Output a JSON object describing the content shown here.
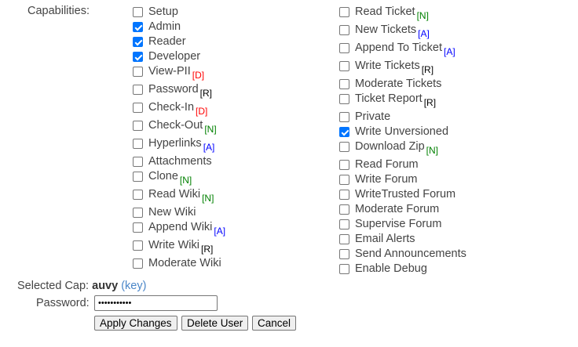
{
  "capabilities_label": "Capabilities:",
  "flag_colors": {
    "D": "#ff0000",
    "N": "#008000",
    "A": "#0000ff",
    "R": "#000000"
  },
  "left_column": [
    {
      "label": "Setup",
      "checked": false,
      "flag": ""
    },
    {
      "label": "Admin",
      "checked": true,
      "flag": ""
    },
    {
      "label": "Reader",
      "checked": true,
      "flag": ""
    },
    {
      "label": "Developer",
      "checked": true,
      "flag": ""
    },
    {
      "label": "View-PII",
      "checked": false,
      "flag": "D"
    },
    {
      "label": "Password",
      "checked": false,
      "flag": "R"
    },
    {
      "label": "Check-In",
      "checked": false,
      "flag": "D"
    },
    {
      "label": "Check-Out",
      "checked": false,
      "flag": "N"
    },
    {
      "label": "Hyperlinks",
      "checked": false,
      "flag": "A"
    },
    {
      "label": "Attachments",
      "checked": false,
      "flag": ""
    },
    {
      "label": "Clone",
      "checked": false,
      "flag": "N"
    },
    {
      "label": "Read Wiki",
      "checked": false,
      "flag": "N"
    },
    {
      "label": "New Wiki",
      "checked": false,
      "flag": ""
    },
    {
      "label": "Append Wiki",
      "checked": false,
      "flag": "A"
    },
    {
      "label": "Write Wiki",
      "checked": false,
      "flag": "R"
    },
    {
      "label": "Moderate Wiki",
      "checked": false,
      "flag": ""
    }
  ],
  "right_column": [
    {
      "label": "Read Ticket",
      "checked": false,
      "flag": "N"
    },
    {
      "label": "New Tickets",
      "checked": false,
      "flag": "A"
    },
    {
      "label": "Append To Ticket",
      "checked": false,
      "flag": "A"
    },
    {
      "label": "Write Tickets",
      "checked": false,
      "flag": "R"
    },
    {
      "label": "Moderate Tickets",
      "checked": false,
      "flag": ""
    },
    {
      "label": "Ticket Report",
      "checked": false,
      "flag": "R"
    },
    {
      "label": "Private",
      "checked": false,
      "flag": ""
    },
    {
      "label": "Write Unversioned",
      "checked": true,
      "flag": ""
    },
    {
      "label": "Download Zip",
      "checked": false,
      "flag": "N"
    },
    {
      "label": "Read Forum",
      "checked": false,
      "flag": ""
    },
    {
      "label": "Write Forum",
      "checked": false,
      "flag": ""
    },
    {
      "label": "WriteTrusted Forum",
      "checked": false,
      "flag": ""
    },
    {
      "label": "Moderate Forum",
      "checked": false,
      "flag": ""
    },
    {
      "label": "Supervise Forum",
      "checked": false,
      "flag": ""
    },
    {
      "label": "Email Alerts",
      "checked": false,
      "flag": ""
    },
    {
      "label": "Send Announcements",
      "checked": false,
      "flag": ""
    },
    {
      "label": "Enable Debug",
      "checked": false,
      "flag": ""
    }
  ],
  "selected_cap": {
    "label": "Selected Cap:",
    "value": "auvy",
    "key_link": "(key)"
  },
  "password": {
    "label": "Password:",
    "value": "•••••••••••"
  },
  "buttons": {
    "apply": "Apply Changes",
    "delete": "Delete User",
    "cancel": "Cancel"
  }
}
